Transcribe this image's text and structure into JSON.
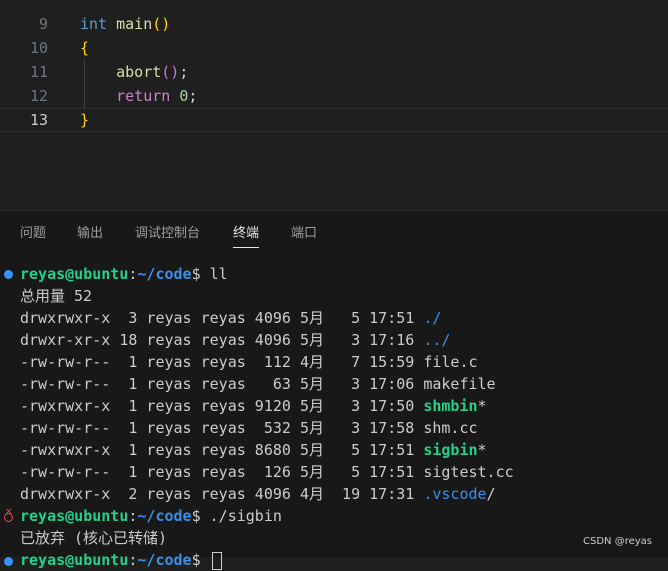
{
  "editor": {
    "lines": [
      {
        "num": "9",
        "tokens": [
          {
            "t": "int",
            "c": "kw"
          },
          {
            "t": " ",
            "c": "plain"
          },
          {
            "t": "main",
            "c": "fn"
          },
          {
            "t": "()",
            "c": "brace"
          }
        ]
      },
      {
        "num": "10",
        "tokens": [
          {
            "t": "{",
            "c": "brace"
          }
        ]
      },
      {
        "num": "11",
        "tokens": [
          {
            "t": "    ",
            "c": "plain"
          },
          {
            "t": "abort",
            "c": "fn"
          },
          {
            "t": "()",
            "c": "paren"
          },
          {
            "t": ";",
            "c": "plain"
          }
        ]
      },
      {
        "num": "12",
        "tokens": [
          {
            "t": "    ",
            "c": "plain"
          },
          {
            "t": "return",
            "c": "kw2"
          },
          {
            "t": " ",
            "c": "plain"
          },
          {
            "t": "0",
            "c": "num"
          },
          {
            "t": ";",
            "c": "plain"
          }
        ]
      },
      {
        "num": "13",
        "tokens": [
          {
            "t": "}",
            "c": "brace"
          }
        ]
      }
    ]
  },
  "panel": {
    "tabs": [
      "问题",
      "输出",
      "调试控制台",
      "终端",
      "端口"
    ],
    "active_tab": "终端"
  },
  "terminal": {
    "prompt_user": "reyas@ubuntu",
    "prompt_sep": ":",
    "prompt_path": "~/code",
    "prompt_end": "$ ",
    "cmd1": "ll",
    "total": "总用量 52",
    "listing": [
      {
        "meta": "drwxrwxr-x  3 reyas reyas 4096 5月   5 17:51 ",
        "name": "./",
        "kind": "dir",
        "suffix": ""
      },
      {
        "meta": "drwxr-xr-x 18 reyas reyas 4096 5月   3 17:16 ",
        "name": "../",
        "kind": "dir",
        "suffix": ""
      },
      {
        "meta": "-rw-rw-r--  1 reyas reyas  112 4月   7 15:59 ",
        "name": "file.c",
        "kind": "file",
        "suffix": ""
      },
      {
        "meta": "-rw-rw-r--  1 reyas reyas   63 5月   3 17:06 ",
        "name": "makefile",
        "kind": "file",
        "suffix": ""
      },
      {
        "meta": "-rwxrwxr-x  1 reyas reyas 9120 5月   3 17:50 ",
        "name": "shmbin",
        "kind": "exe",
        "suffix": "*"
      },
      {
        "meta": "-rw-rw-r--  1 reyas reyas  532 5月   3 17:58 ",
        "name": "shm.cc",
        "kind": "file",
        "suffix": ""
      },
      {
        "meta": "-rwxrwxr-x  1 reyas reyas 8680 5月   5 17:51 ",
        "name": "sigbin",
        "kind": "exe",
        "suffix": "*"
      },
      {
        "meta": "-rw-rw-r--  1 reyas reyas  126 5月   5 17:51 ",
        "name": "sigtest.cc",
        "kind": "file",
        "suffix": ""
      },
      {
        "meta": "drwxrwxr-x  2 reyas reyas 4096 4月  19 17:31 ",
        "name": ".vscode",
        "kind": "dir",
        "suffix": "/"
      }
    ],
    "cmd2": "./sigbin",
    "abort_msg": "已放弃 (核心已转储)"
  },
  "watermark": "CSDN @reyas",
  "colors": {
    "background": "#1f1f1f",
    "panel": "#181818",
    "prompt_user": "#23d18b",
    "prompt_path": "#3b8eea",
    "error_dot": "#f14c4c",
    "ok_dot": "#3794ff"
  }
}
